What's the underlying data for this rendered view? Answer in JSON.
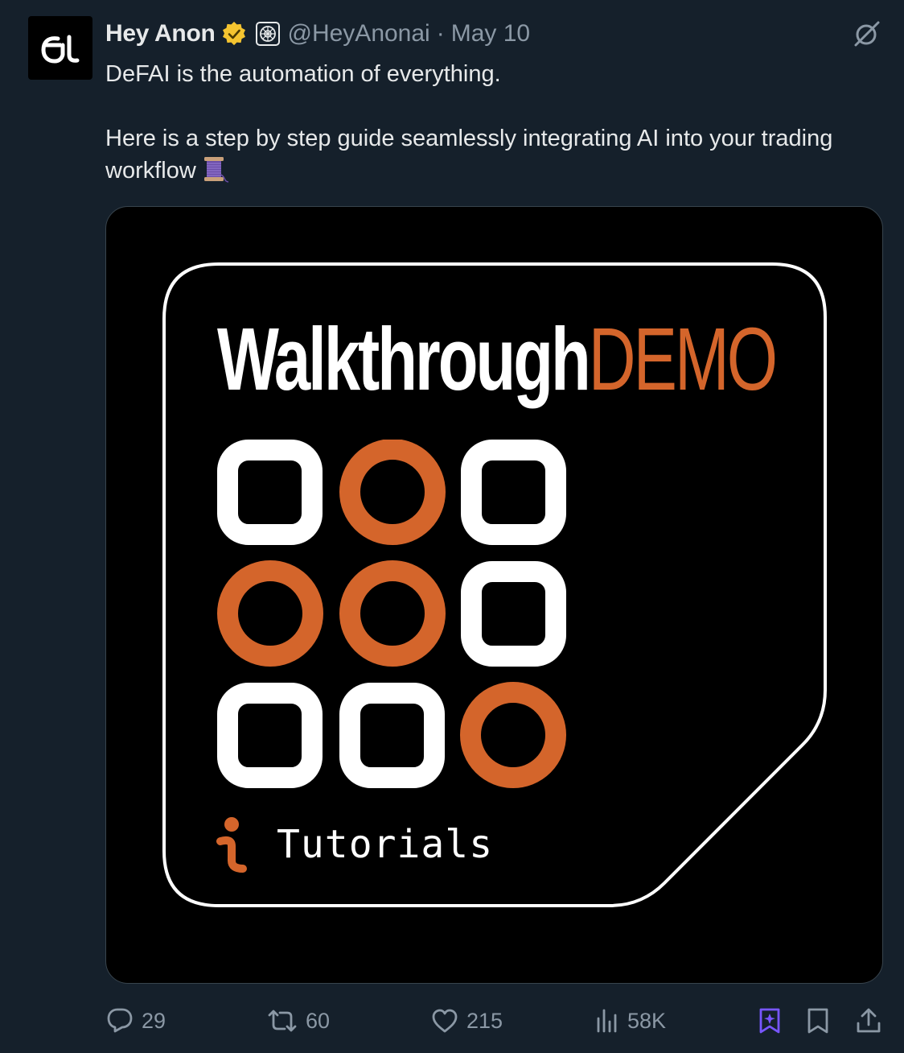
{
  "tweet": {
    "author_name": "Hey Anon",
    "handle": "@HeyAnonai",
    "separator": "·",
    "date": "May 10",
    "text_line1": "DeFAI is the automation of everything.",
    "text_line2": "Here is a step by step guide seamlessly integrating AI into your trading workflow",
    "avatar_logo": "ai-logo",
    "verified_color": "#f4c430",
    "icons": {
      "verified": "verified-badge-icon",
      "affiliate": "affiliate-badge-icon",
      "grok": "grok-icon",
      "thread": "spool-of-thread-emoji"
    }
  },
  "media": {
    "title_main": "Walkthrough",
    "title_accent": "DEMO",
    "accent_color": "#d4652b",
    "subtitle": "Tutorials",
    "grid": [
      [
        "square",
        "circle",
        "square"
      ],
      [
        "circle",
        "circle",
        "square"
      ],
      [
        "square",
        "square",
        "circle"
      ]
    ]
  },
  "actions": {
    "replies": "29",
    "reposts": "60",
    "likes": "215",
    "views": "58K",
    "icons": [
      "reply-icon",
      "repost-icon",
      "like-icon",
      "views-icon",
      "grok-bookmark-icon",
      "bookmark-icon",
      "share-icon"
    ],
    "grok_bookmark_color": "#7856ff"
  }
}
